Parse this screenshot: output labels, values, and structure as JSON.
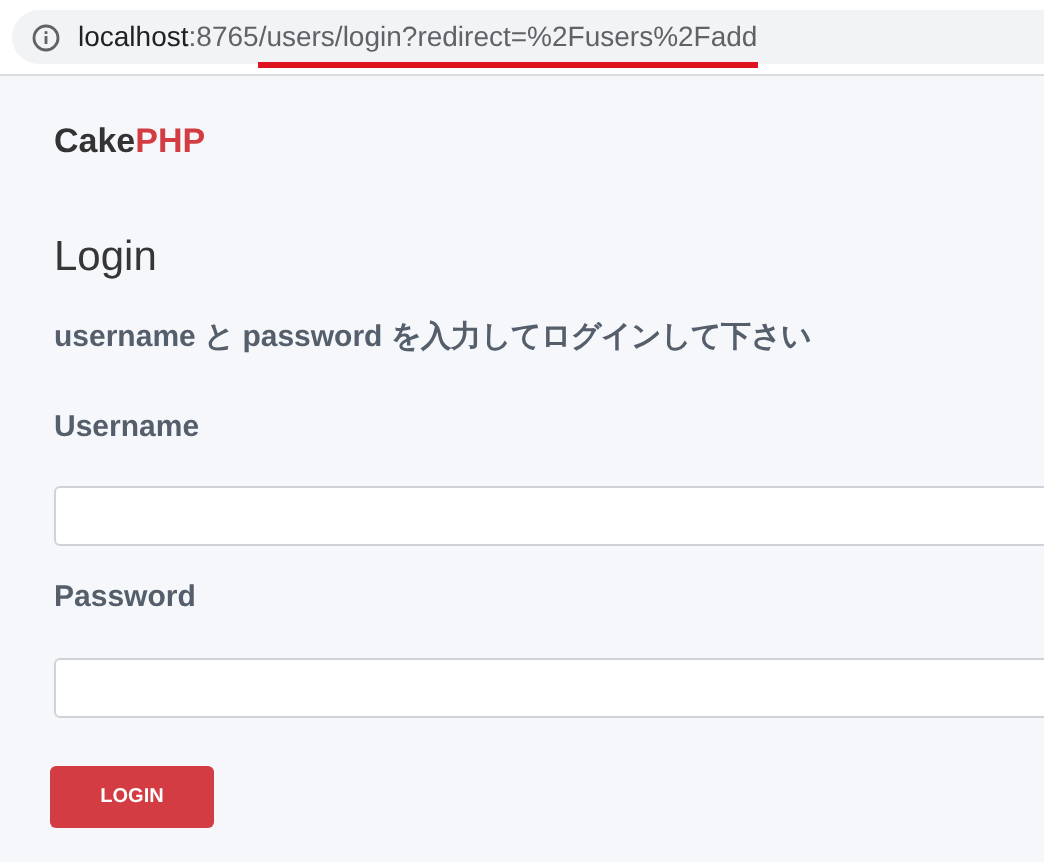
{
  "address_bar": {
    "url_parts": [
      {
        "text": "localhost",
        "kind": "host",
        "underlined": false
      },
      {
        "text": ":8765",
        "kind": "path",
        "underlined": false
      },
      {
        "text": "/users/login?redirect=%2Fusers%2Fadd",
        "kind": "path",
        "underlined": true
      }
    ]
  },
  "brand": [
    "Cake",
    "PHP"
  ],
  "heading": "Login",
  "instruction": "username と password を入力してログインして下さい",
  "fields": [
    {
      "label": "Username"
    },
    {
      "label": "Password"
    }
  ],
  "submit": "LOGIN"
}
